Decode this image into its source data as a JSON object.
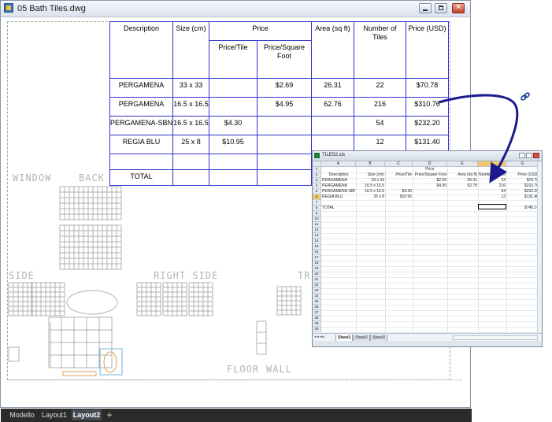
{
  "window": {
    "title": "05 Bath Tiles.dwg",
    "icons": {
      "app": "autocad-file-icon",
      "minimize": "minimize-icon",
      "maximize": "maximize-icon",
      "close": "close-icon"
    }
  },
  "table": {
    "headers": {
      "description": "Description",
      "size": "Size (cm)",
      "price_group": "Price",
      "price_tile": "Price/Tile",
      "price_sqft": "Price/Square Foot",
      "area": "Area (sq ft)",
      "number": "Number of Tiles",
      "price_usd": "Price (USD)"
    },
    "rows": [
      {
        "description": "PERGAMENA",
        "size": "33 x 33",
        "price_tile": "",
        "price_sqft": "$2.69",
        "area": "26.31",
        "number": "22",
        "price_usd": "$70.78"
      },
      {
        "description": "PERGAMENA",
        "size": "16.5 x 16.5",
        "price_tile": "",
        "price_sqft": "$4.95",
        "area": "62.76",
        "number": "216",
        "price_usd": "$310.76"
      },
      {
        "description": "PERGAMENA-SBN",
        "size": "16.5 x 16.5",
        "price_tile": "$4.30",
        "price_sqft": "",
        "area": "",
        "number": "54",
        "price_usd": "$232.20"
      },
      {
        "description": "REGIA BLU",
        "size": "25 x 8",
        "price_tile": "$10.95",
        "price_sqft": "",
        "area": "",
        "number": "12",
        "price_usd": "$131.40"
      },
      {
        "description": "",
        "size": "",
        "price_tile": "",
        "price_sqft": "",
        "area": "",
        "number": "",
        "price_usd": ""
      },
      {
        "description": "TOTAL",
        "size": "",
        "price_tile": "",
        "price_sqft": "",
        "area": "",
        "number": "",
        "price_usd": ""
      }
    ]
  },
  "drawing_labels": {
    "window": "WINDOW",
    "back": "BACK",
    "side": "SIDE",
    "right_side": "RIGHT SIDE",
    "tr": "TR",
    "floor": "FLOOR",
    "wall": "WALL"
  },
  "layout_tabs": [
    "Modello",
    "Layout1",
    "Layout2"
  ],
  "active_layout_tab": "Layout2",
  "add_tab_icon": "plus-icon",
  "link_icon": "chain-link-icon",
  "spreadsheet": {
    "title": "TILES2.xls",
    "columns": [
      "A",
      "B",
      "C",
      "D",
      "E",
      "F",
      "G"
    ],
    "selected_column": "F",
    "selected_row": "6",
    "row_numbers": [
      "1",
      "2",
      "3",
      "4",
      "5",
      "6",
      "7",
      "8",
      "9",
      "10",
      "11",
      "12",
      "13",
      "14",
      "15",
      "16",
      "17",
      "18",
      "19",
      "20",
      "21",
      "22",
      "23",
      "24",
      "25",
      "26",
      "27",
      "28",
      "29",
      "30"
    ],
    "header_row1": {
      "price": "Price"
    },
    "header_row2": [
      "Description",
      "Size (cm)",
      "Price/Tile",
      "Price/Square Foot",
      "Area (sq ft)",
      "Number of Tiles",
      "Price (USD)"
    ],
    "rows": [
      [
        "PERGAMENA",
        "33 x 33",
        "",
        "$2.69",
        "26.31",
        "22",
        "$70.78"
      ],
      [
        "PERGAMENA",
        "16.5 x 16.5",
        "",
        "$4.95",
        "62.78",
        "216",
        "$310.76"
      ],
      [
        "PERGAMENA-SBN",
        "16.5 x 16.5",
        "$4.30",
        "",
        "",
        "54",
        "$232.20"
      ],
      [
        "REGIA BLU",
        "25 x 8",
        "$10.95",
        "",
        "",
        "12",
        "$131.40"
      ]
    ],
    "total_label": "TOTAL",
    "total_value": "$745.14",
    "sheets": [
      "Sheet1",
      "Sheet2",
      "Sheet3"
    ],
    "active_sheet": "Sheet1"
  },
  "colors": {
    "table_line": "#3333cc",
    "arrow": "#1a1a8c",
    "drawing_line": "#b0b0b0"
  }
}
